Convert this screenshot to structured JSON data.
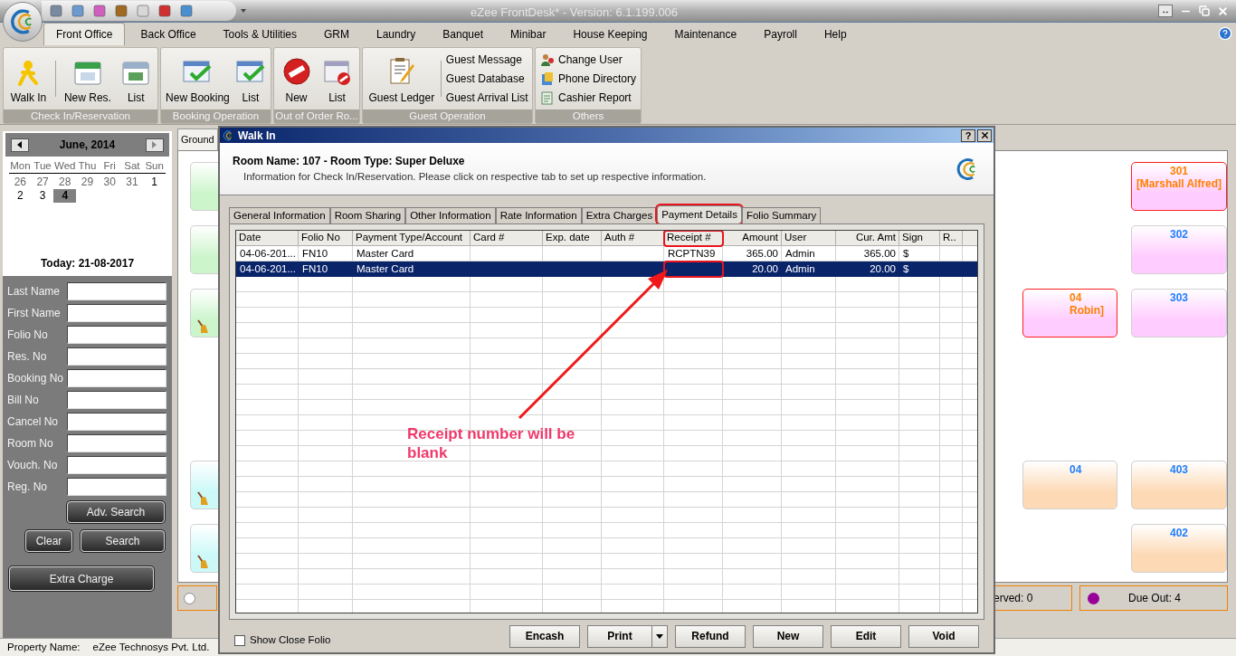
{
  "window": {
    "title": "eZee FrontDesk* - Version: 6.1.199.006",
    "resize_glyph": "↔"
  },
  "menu": [
    {
      "label": "Front Office",
      "selected": true
    },
    {
      "label": "Back Office",
      "selected": false
    },
    {
      "label": "Tools & Utilities",
      "selected": false
    },
    {
      "label": "GRM",
      "selected": false
    },
    {
      "label": "Laundry",
      "selected": false
    },
    {
      "label": "Banquet",
      "selected": false
    },
    {
      "label": "Minibar",
      "selected": false
    },
    {
      "label": "House Keeping",
      "selected": false
    },
    {
      "label": "Maintenance",
      "selected": false
    },
    {
      "label": "Payroll",
      "selected": false
    },
    {
      "label": "Help",
      "selected": false
    }
  ],
  "ribbon": [
    {
      "title": "Check In/Reservation",
      "items": [
        {
          "label": "Walk In",
          "kind": "walk"
        },
        {
          "label": "New Res.",
          "kind": "calendar"
        },
        {
          "label": "List",
          "kind": "calendar-list"
        }
      ]
    },
    {
      "title": "Booking Operation",
      "items": [
        {
          "label": "New Booking",
          "kind": "booking"
        },
        {
          "label": "List",
          "kind": "booking-list"
        }
      ]
    },
    {
      "title": "Out of Order Ro...",
      "items": [
        {
          "label": "New",
          "kind": "block"
        },
        {
          "label": "List",
          "kind": "block-list"
        }
      ]
    },
    {
      "title": "Guest Operation",
      "items": [
        {
          "label": "Guest Ledger",
          "kind": "ledger"
        },
        {
          "label": "Guest Message",
          "kind": "text"
        },
        {
          "label": "Guest Database",
          "kind": "text"
        },
        {
          "label": "Guest Arrival List",
          "kind": "text"
        }
      ]
    },
    {
      "title": "Others",
      "items": [
        {
          "label": "Change User",
          "kind": "users"
        },
        {
          "label": "Phone Directory",
          "kind": "phone"
        },
        {
          "label": "Cashier Report",
          "kind": "report"
        }
      ]
    }
  ],
  "calendar": {
    "month": "June, 2014",
    "weekdays": [
      "Mon",
      "Tue",
      "Wed",
      "Thu",
      "Fri",
      "Sat",
      "Sun"
    ],
    "days": [
      {
        "label": "26",
        "muted": true,
        "selected": false
      },
      {
        "label": "27",
        "muted": true,
        "selected": false
      },
      {
        "label": "28",
        "muted": true,
        "selected": false
      },
      {
        "label": "29",
        "muted": true,
        "selected": false
      },
      {
        "label": "30",
        "muted": true,
        "selected": false
      },
      {
        "label": "31",
        "muted": true,
        "selected": false
      },
      {
        "label": "1",
        "muted": false,
        "selected": false
      },
      {
        "label": "2",
        "muted": false,
        "selected": false
      },
      {
        "label": "3",
        "muted": false,
        "selected": false
      },
      {
        "label": "4",
        "muted": false,
        "selected": true
      }
    ],
    "today": "Today: 21-08-2017"
  },
  "search": {
    "fields": [
      {
        "label": "Last Name"
      },
      {
        "label": "First Name"
      },
      {
        "label": "Folio No"
      },
      {
        "label": "Res. No"
      },
      {
        "label": "Booking No"
      },
      {
        "label": "Bill No"
      },
      {
        "label": "Cancel No"
      },
      {
        "label": "Room No"
      },
      {
        "label": "Vouch. No"
      },
      {
        "label": "Reg. No"
      }
    ],
    "advanced": "Adv. Search",
    "clear": "Clear",
    "search": "Search"
  },
  "extra_charge": "Extra Charge",
  "floor_tabs": [
    {
      "label": "Ground",
      "selected": true
    }
  ],
  "room_blocks": [
    {
      "rows": [
        {
          "tiles": [
            {
              "kind": "room",
              "color": "#ccf5cc",
              "occupied": false,
              "dirty": false
            },
            {
              "kind": "blank"
            },
            {
              "kind": "blank"
            },
            {
              "kind": "room",
              "number": "301",
              "guest": "[Marshall Alfred]",
              "color": "#ffccff",
              "occupied": true,
              "dirty": false
            }
          ]
        },
        {
          "tiles": [
            {
              "kind": "room",
              "color": "#ccf5cc",
              "occupied": false,
              "dirty": false
            },
            {
              "kind": "blank"
            },
            {
              "kind": "blank"
            },
            {
              "kind": "room",
              "number": "302",
              "color": "#ffccff",
              "occupied": false,
              "dirty": false
            }
          ]
        },
        {
          "tiles": [
            {
              "kind": "room",
              "color": "#ccf5cc",
              "occupied": false,
              "dirty": true
            },
            {
              "kind": "blank"
            },
            {
              "kind": "room",
              "number": "04",
              "guest": "Robin]",
              "color": "#ffccff",
              "occupied": true,
              "dirty": false
            },
            {
              "kind": "room",
              "number": "303",
              "color": "#ffccff",
              "occupied": false,
              "dirty": false
            }
          ]
        }
      ]
    },
    {
      "rows": [
        {
          "tiles": [
            {
              "kind": "room",
              "color": "#ccf8f8",
              "occupied": false,
              "dirty": true
            },
            {
              "kind": "blank"
            },
            {
              "kind": "room",
              "number": "04",
              "color": "#fdd9b5",
              "occupied": false,
              "dirty": false
            },
            {
              "kind": "room",
              "number": "403",
              "color": "#fdd9b5",
              "occupied": false,
              "dirty": false
            }
          ]
        },
        {
          "tiles": [
            {
              "kind": "room",
              "color": "#ccf8f8",
              "occupied": false,
              "dirty": true
            },
            {
              "kind": "blank"
            },
            {
              "kind": "blank"
            },
            {
              "kind": "room",
              "number": "402",
              "color": "#fdd9b5",
              "occupied": false,
              "dirty": false
            }
          ]
        }
      ]
    }
  ],
  "legend": [
    {
      "color": "#ffffff"
    },
    {
      "label": "erved: 0"
    },
    {
      "label": "Due Out: 4",
      "color": "#990099"
    }
  ],
  "footer": {
    "label": "Property Name:",
    "value": "eZee Technosys Pvt. Ltd."
  },
  "dialog": {
    "title": "Walk In",
    "help": "?",
    "heading": "Room Name: 107 - Room Type: Super Deluxe",
    "subheading": "Information for Check In/Reservation. Please click on respective tab to set up respective information.",
    "tabs": [
      {
        "label": "General Information",
        "selected": false,
        "highlighted": false
      },
      {
        "label": "Room Sharing",
        "selected": false,
        "highlighted": false
      },
      {
        "label": "Other Information",
        "selected": false,
        "highlighted": false
      },
      {
        "label": "Rate Information",
        "selected": false,
        "highlighted": false
      },
      {
        "label": "Extra Charges",
        "selected": false,
        "highlighted": false
      },
      {
        "label": "Payment Details",
        "selected": true,
        "highlighted": true
      },
      {
        "label": "Folio Summary",
        "selected": false,
        "highlighted": false
      }
    ],
    "table": {
      "columns": [
        {
          "label": "Date",
          "highlighted": false
        },
        {
          "label": "Folio No",
          "highlighted": false
        },
        {
          "label": "Payment Type/Account",
          "highlighted": false
        },
        {
          "label": "Card #",
          "highlighted": false
        },
        {
          "label": "Exp. date",
          "highlighted": false
        },
        {
          "label": "Auth #",
          "highlighted": false
        },
        {
          "label": "Receipt #",
          "highlighted": true
        },
        {
          "label": "Amount",
          "highlighted": false
        },
        {
          "label": "User",
          "highlighted": false
        },
        {
          "label": "Cur. Amt",
          "highlighted": false
        },
        {
          "label": "Sign",
          "highlighted": false
        },
        {
          "label": "R..",
          "highlighted": false
        }
      ],
      "rows": [
        {
          "selected": false,
          "cells": [
            "04-06-201...",
            "FN10",
            "Master Card",
            null,
            null,
            null,
            {
              "text": "RCPTN39",
              "highlighted": false
            },
            "365.00",
            "Admin",
            "365.00",
            "$",
            null
          ]
        },
        {
          "selected": true,
          "cells": [
            "04-06-201...",
            "FN10",
            "Master Card",
            null,
            null,
            null,
            {
              "highlighted": true
            },
            "20.00",
            "Admin",
            "20.00",
            "$",
            null
          ]
        }
      ]
    },
    "show_close_folio": {
      "label": "Show Close Folio",
      "checked": false
    },
    "buttons": [
      {
        "label": "Encash",
        "kind": "plain"
      },
      {
        "label": "Print",
        "kind": "split"
      },
      {
        "label": "Refund",
        "kind": "plain"
      },
      {
        "label": "New",
        "kind": "plain"
      },
      {
        "label": "Edit",
        "kind": "plain"
      },
      {
        "label": "Void",
        "kind": "plain"
      }
    ],
    "annotation": "Receipt number will be blank"
  }
}
